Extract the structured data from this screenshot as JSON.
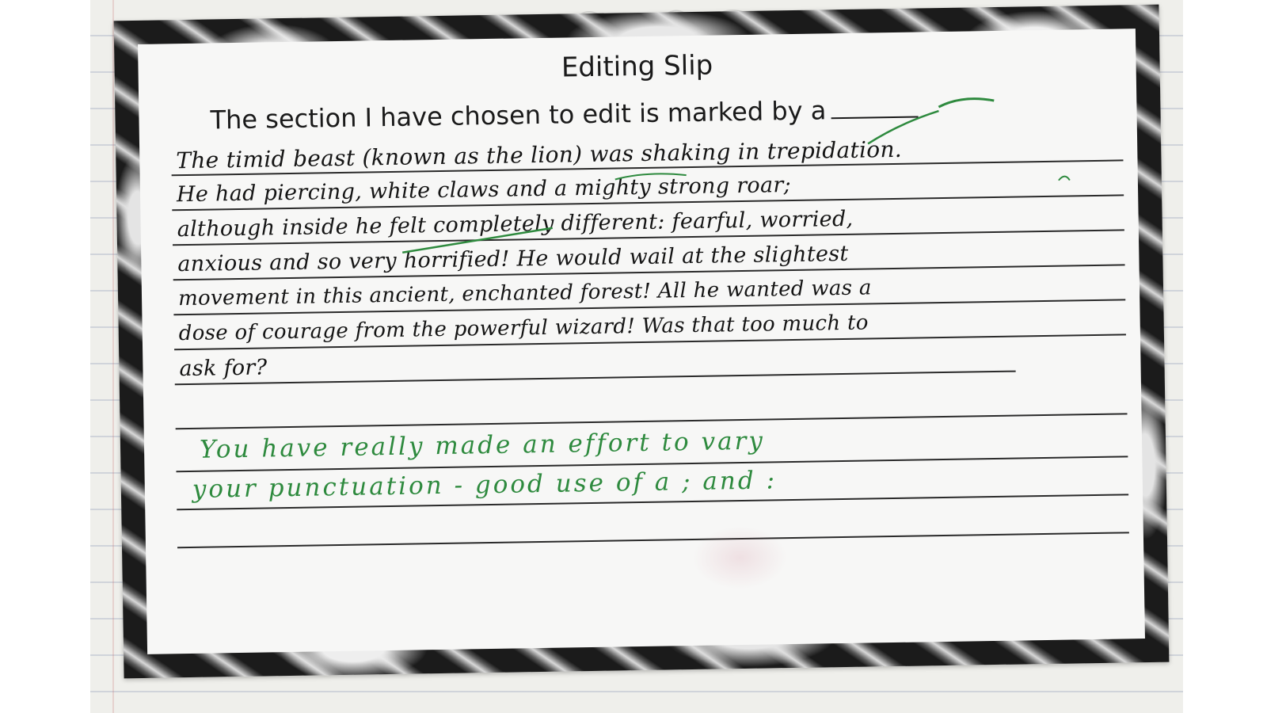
{
  "slip": {
    "title": "Editing Slip",
    "prompt": "The section I have chosen to edit is marked by a"
  },
  "pupil_writing": {
    "lines": [
      "The timid beast (known as the lion) was shaking in trepidation.",
      "He had piercing, white claws and a mighty strong roar;",
      "although inside he felt completely different: fearful, worried,",
      "anxious and so very horrified! He would wail at the slightest",
      "movement in this ancient, enchanted forest! All he wanted was a",
      "dose of courage from the powerful wizard! Was that too much to",
      "ask for?"
    ]
  },
  "teacher_comment": {
    "lines": [
      "You have really made an effort to vary",
      "your punctuation - good use of a ; and :"
    ],
    "ink_color": "#2e8a3e"
  },
  "colors": {
    "pupil_ink": "#151515",
    "teacher_ink": "#2e8a3e",
    "slip_border": "#1b1b1b"
  }
}
